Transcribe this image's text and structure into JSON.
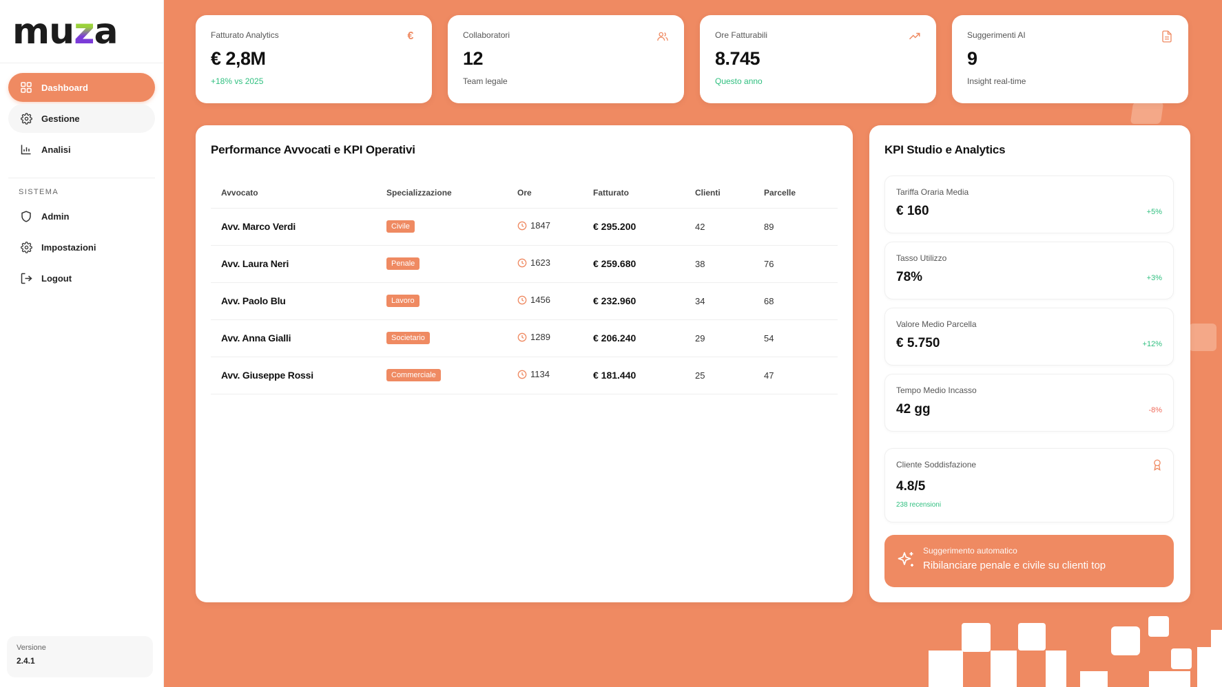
{
  "brand": {
    "logo_pre": "mu",
    "logo_z": "z",
    "logo_post": "a"
  },
  "sidebar": {
    "items": [
      {
        "label": "Dashboard",
        "icon": "grid-icon",
        "active": true
      },
      {
        "label": "Gestione",
        "icon": "gear-icon"
      },
      {
        "label": "Analisi",
        "icon": "bar-chart-icon"
      }
    ],
    "section_label": "SISTEMA",
    "system_items": [
      {
        "label": "Admin",
        "icon": "shield-icon"
      },
      {
        "label": "Impostazioni",
        "icon": "gear-icon"
      },
      {
        "label": "Logout",
        "icon": "logout-icon"
      }
    ],
    "version_label": "Versione",
    "version_value": "2.4.1"
  },
  "stats": [
    {
      "label": "Fatturato Analytics",
      "value": "€ 2,8M",
      "sub": "+18% vs 2025",
      "sub_color": "green",
      "icon": "euro-icon"
    },
    {
      "label": "Collaboratori",
      "value": "12",
      "sub": "Team legale",
      "sub_color": "gray",
      "icon": "users-icon"
    },
    {
      "label": "Ore Fatturabili",
      "value": "8.745",
      "sub": "Questo anno",
      "sub_color": "green",
      "icon": "trending-up-icon"
    },
    {
      "label": "Suggerimenti AI",
      "value": "9",
      "sub": "Insight real-time",
      "sub_color": "gray",
      "icon": "document-icon"
    }
  ],
  "performance": {
    "title": "Performance Avvocati e KPI Operativi",
    "columns": [
      "Avvocato",
      "Specializzazione",
      "Ore",
      "Fatturato",
      "Clienti",
      "Parcelle"
    ],
    "rows": [
      {
        "name": "Avv. Marco Verdi",
        "spec": "Civile",
        "hours": "1847",
        "revenue": "€ 295.200",
        "clients": "42",
        "fees": "89"
      },
      {
        "name": "Avv. Laura Neri",
        "spec": "Penale",
        "hours": "1623",
        "revenue": "€ 259.680",
        "clients": "38",
        "fees": "76"
      },
      {
        "name": "Avv. Paolo Blu",
        "spec": "Lavoro",
        "hours": "1456",
        "revenue": "€ 232.960",
        "clients": "34",
        "fees": "68"
      },
      {
        "name": "Avv. Anna Gialli",
        "spec": "Societario",
        "hours": "1289",
        "revenue": "€ 206.240",
        "clients": "29",
        "fees": "54"
      },
      {
        "name": "Avv. Giuseppe Rossi",
        "spec": "Commerciale",
        "hours": "1134",
        "revenue": "€ 181.440",
        "clients": "25",
        "fees": "47"
      }
    ]
  },
  "kpi": {
    "title": "KPI Studio e Analytics",
    "items": [
      {
        "label": "Tariffa Oraria Media",
        "value": "€ 160",
        "trend": "+5%",
        "trend_color": "green"
      },
      {
        "label": "Tasso Utilizzo",
        "value": "78%",
        "trend": "+3%",
        "trend_color": "green"
      },
      {
        "label": "Valore Medio Parcella",
        "value": "€ 5.750",
        "trend": "+12%",
        "trend_color": "green"
      },
      {
        "label": "Tempo Medio Incasso",
        "value": "42 gg",
        "trend": "-8%",
        "trend_color": "red"
      }
    ],
    "satisfaction": {
      "label": "Cliente Soddisfazione",
      "value": "4.8/5",
      "sub": "238 recensioni",
      "icon": "award-icon"
    },
    "suggestion": {
      "label": "Suggerimento automatico",
      "text": "Ribilanciare penale e civile su clienti top",
      "icon": "sparkle-icon"
    }
  },
  "colors": {
    "accent": "#ef8a62",
    "positive": "#2fbf7f",
    "negative": "#ef6a5a"
  }
}
